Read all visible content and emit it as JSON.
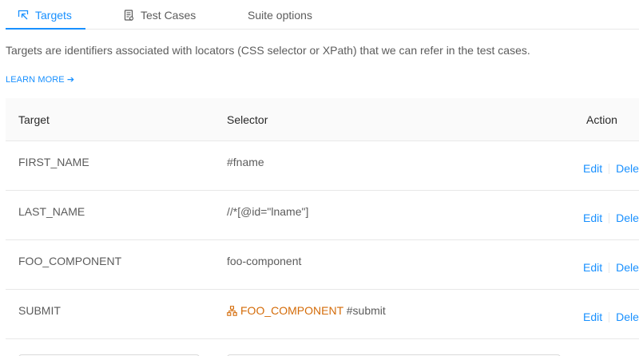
{
  "tabs": [
    {
      "label": "Targets",
      "icon": "target-select-icon",
      "active": true
    },
    {
      "label": "Test Cases",
      "icon": "document-icon",
      "active": false
    },
    {
      "label": "Suite options",
      "icon": "",
      "active": false
    }
  ],
  "description": "Targets are identifiers associated with locators (CSS selector or XPath) that we can refer in the test cases.",
  "learn_more": "LEARN MORE ➔",
  "table": {
    "headers": {
      "target": "Target",
      "selector": "Selector",
      "action": "Action"
    },
    "rows": [
      {
        "target": "FIRST_NAME",
        "selector_ref": "",
        "selector": "#fname"
      },
      {
        "target": "LAST_NAME",
        "selector_ref": "",
        "selector": "//*[@id=\"lname\"]"
      },
      {
        "target": "FOO_COMPONENT",
        "selector_ref": "",
        "selector": "foo-component"
      },
      {
        "target": "SUBMIT",
        "selector_ref": "FOO_COMPONENT",
        "selector": "#submit"
      }
    ],
    "action_edit": "Edit",
    "action_delete": "Dele"
  },
  "colors": {
    "accent": "#1890ff",
    "reference": "#d46b08",
    "border": "#e8e8e8",
    "header_bg": "#fafafa"
  }
}
